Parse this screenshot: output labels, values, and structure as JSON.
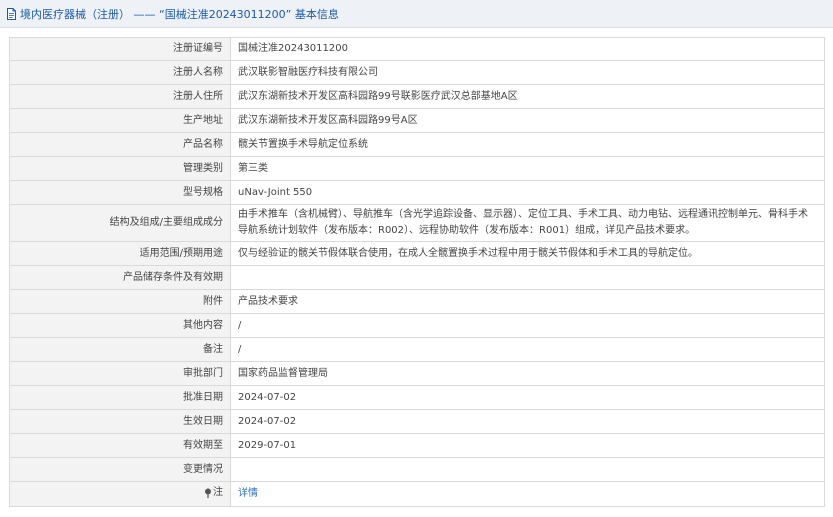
{
  "header": {
    "title": "境内医疗器械（注册） —— “国械注准20243011200” 基本信息"
  },
  "rows": [
    {
      "label": "注册证编号",
      "value": "国械注准20243011200"
    },
    {
      "label": "注册人名称",
      "value": "武汉联影智融医疗科技有限公司"
    },
    {
      "label": "注册人住所",
      "value": "武汉东湖新技术开发区高科园路99号联影医疗武汉总部基地A区"
    },
    {
      "label": "生产地址",
      "value": "武汉东湖新技术开发区高科园路99号A区"
    },
    {
      "label": "产品名称",
      "value": "髋关节置换手术导航定位系统"
    },
    {
      "label": "管理类别",
      "value": "第三类"
    },
    {
      "label": "型号规格",
      "value": "uNav-Joint 550"
    },
    {
      "label": "结构及组成/主要组成成分",
      "value": "由手术推车（含机械臂）、导航推车（含光学追踪设备、显示器）、定位工具、手术工具、动力电钻、远程通讯控制单元、骨科手术导航系统计划软件（发布版本：R002）、远程协助软件（发布版本：R001）组成，详见产品技术要求。"
    },
    {
      "label": "适用范围/预期用途",
      "value": "仅与经验证的髋关节假体联合使用，在成人全髋置换手术过程中用于髋关节假体和手术工具的导航定位。"
    },
    {
      "label": "产品储存条件及有效期",
      "value": ""
    },
    {
      "label": "附件",
      "value": "产品技术要求"
    },
    {
      "label": "其他内容",
      "value": "/"
    },
    {
      "label": "备注",
      "value": "/"
    },
    {
      "label": "审批部门",
      "value": "国家药品监督管理局"
    },
    {
      "label": "批准日期",
      "value": "2024-07-02"
    },
    {
      "label": "生效日期",
      "value": "2024-07-02"
    },
    {
      "label": "有效期至",
      "value": "2029-07-01"
    },
    {
      "label": "变更情况",
      "value": ""
    }
  ],
  "note": {
    "label": "注",
    "link_text": "详情"
  },
  "colors": {
    "title_blue": "#1b5aa8",
    "link_blue": "#2b6fc2",
    "label_bg": "#f3f3f3",
    "border": "#d9d9d9"
  }
}
